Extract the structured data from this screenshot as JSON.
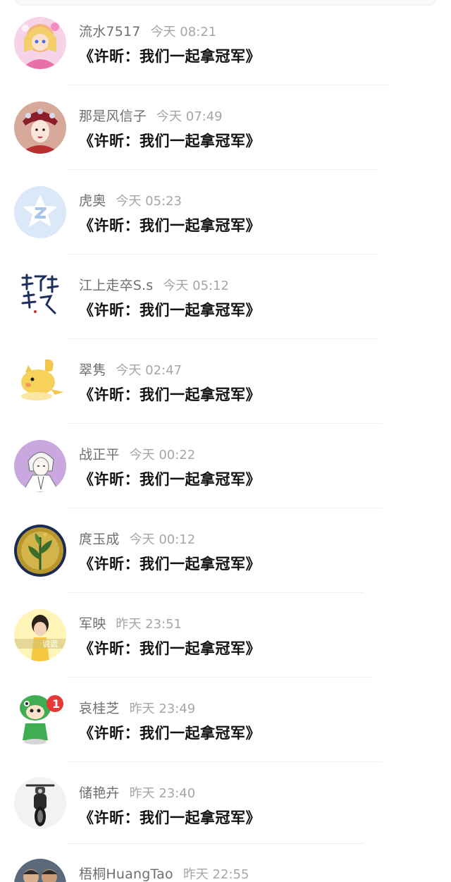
{
  "comments": [
    {
      "name": "流水7517",
      "time": "今天 08:21",
      "content": "《许昕：我们一起拿冠军》",
      "avatar": "anime-girl-pink"
    },
    {
      "name": "那是风信子",
      "time": "今天 07:49",
      "content": "《许昕：我们一起拿冠军》",
      "avatar": "opera-girl"
    },
    {
      "name": "虎奥",
      "time": "今天 05:23",
      "content": "《许昕：我们一起拿冠军》",
      "avatar": "qq-default"
    },
    {
      "name": "江上走卒S.s",
      "time": "今天 05:12",
      "content": "《许昕：我们一起拿冠军》",
      "avatar": "calligraphy"
    },
    {
      "name": "翠隽",
      "time": "今天 02:47",
      "content": "《许昕：我们一起拿冠军》",
      "avatar": "yellow-cartoon"
    },
    {
      "name": "战正平",
      "time": "今天 00:22",
      "content": "《许昕：我们一起拿冠军》",
      "avatar": "anime-boy-purple"
    },
    {
      "name": "庹玉成",
      "time": "今天 00:12",
      "content": "《许昕：我们一起拿冠军》",
      "avatar": "gold-coin-plant"
    },
    {
      "name": "军映",
      "time": "昨天 23:51",
      "content": "《许昕：我们一起拿冠军》",
      "avatar": "girl-yellow-lie",
      "avatar_text": "说谎"
    },
    {
      "name": "哀桂芝",
      "time": "昨天 23:49",
      "content": "《许昕：我们一起拿冠军》",
      "avatar": "green-dino-badge",
      "avatar_badge": "1"
    },
    {
      "name": "储艳卉",
      "time": "昨天 23:40",
      "content": "《许昕：我们一起拿冠军》",
      "avatar": "motorcycle"
    },
    {
      "name": "梧桐HuangTao",
      "time": "昨天 22:55",
      "content": "",
      "avatar": "two-men-photo"
    }
  ],
  "colors": {
    "name": "#6f6f6f",
    "time": "#a6a6a6",
    "content": "#111111",
    "divider": "#f1f1f1"
  }
}
